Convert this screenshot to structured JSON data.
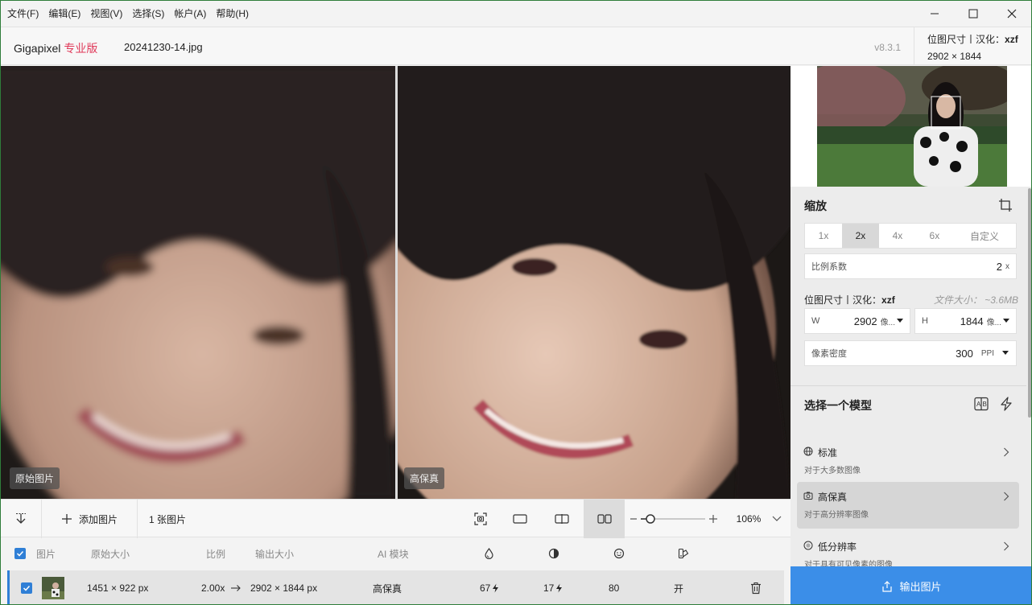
{
  "menubar": {
    "items": [
      "文件(F)",
      "编辑(E)",
      "视图(V)",
      "选择(S)",
      "帐户(A)",
      "帮助(H)"
    ]
  },
  "header": {
    "app_name": "Gigapixel",
    "edition": "专业版",
    "filename": "20241230-14.jpg",
    "version": "v8.3.1",
    "size_label": "位图尺寸丨汉化：",
    "size_author": "xzf",
    "size_value": "2902 × 1844"
  },
  "preview": {
    "left_label": "原始图片",
    "right_label": "高保真"
  },
  "toolbar": {
    "add_label": "添加图片",
    "count_label": "1 张图片",
    "zoom_value": "106%"
  },
  "table": {
    "headers": {
      "image": "图片",
      "original_size": "原始大小",
      "ratio": "比例",
      "output_size": "输出大小",
      "ai_model": "AI 模块"
    },
    "row": {
      "original_size": "1451 × 922 px",
      "ratio": "2.00x",
      "output_size": "2902 × 1844 px",
      "model": "高保真",
      "v1": "67",
      "v2": "17",
      "v3": "80",
      "v4": "开"
    }
  },
  "panel": {
    "scale_title": "缩放",
    "scale_tabs": [
      "1x",
      "2x",
      "4x",
      "6x",
      "自定义"
    ],
    "scale_active": "2x",
    "factor_label": "比例系数",
    "factor_value": "2",
    "factor_unit": "x",
    "bitmap_label": "位图尺寸丨汉化：",
    "bitmap_author": "xzf",
    "filesize": "文件大小：  ~3.6MB",
    "w_label": "W",
    "w_value": "2902",
    "w_unit": "像...",
    "h_label": "H",
    "h_value": "1844",
    "h_unit": "像...",
    "ppi_label": "像素密度",
    "ppi_value": "300",
    "ppi_unit": "PPI",
    "model_title": "选择一个模型",
    "models": [
      {
        "name": "标准",
        "desc": "对于大多数图像"
      },
      {
        "name": "高保真",
        "desc": "对于高分辨率图像"
      },
      {
        "name": "低分辨率",
        "desc": "对于具有可见像素的图像"
      }
    ],
    "export_label": "输出图片"
  },
  "colors": {
    "accent": "#3b8ee8",
    "brand_pro": "#e03a5a",
    "window_border": "#2f7d3a"
  }
}
